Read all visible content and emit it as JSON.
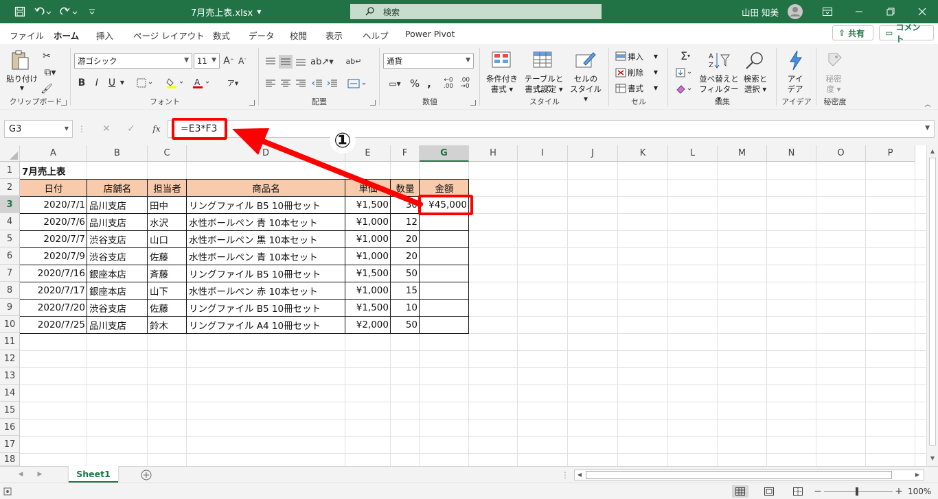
{
  "title": {
    "filename": "7月売上表.xlsx",
    "search": "検索",
    "user": "山田 知美"
  },
  "tabs": [
    "ファイル",
    "ホーム",
    "挿入",
    "ページ レイアウト",
    "数式",
    "データ",
    "校閲",
    "表示",
    "ヘルプ",
    "Power Pivot"
  ],
  "share_label": "共有",
  "comment_label": "コメント",
  "ribbon": {
    "clipboard": {
      "paste": "貼り付け",
      "label": "クリップボード"
    },
    "font": {
      "name": "游ゴシック",
      "size": "11",
      "bold": "B",
      "italic": "I",
      "underline": "U",
      "grow": "A^",
      "shrink": "Aˇ",
      "label": "フォント"
    },
    "alignment": {
      "label": "配置"
    },
    "number": {
      "format": "通貨",
      "label": "数値"
    },
    "styles": {
      "cond1": "条件付き",
      "cond2": "書式",
      "table1": "テーブルとして",
      "table2": "書式設定",
      "cell1": "セルの",
      "cell2": "スタイル",
      "label": "スタイル"
    },
    "cells": {
      "insert": "挿入",
      "delete": "削除",
      "format": "書式",
      "label": "セル"
    },
    "editing": {
      "sort1": "並べ替えと",
      "sort2": "フィルター",
      "find1": "検索と",
      "find2": "選択",
      "label": "編集"
    },
    "ideas": {
      "line1": "アイ",
      "line2": "デア",
      "label": "アイデア"
    },
    "sensitivity": {
      "line1": "秘密",
      "line2": "度",
      "label": "秘密度"
    }
  },
  "namebox": "G3",
  "formula": "=E3*F3",
  "callout": "①",
  "columns": [
    "A",
    "B",
    "C",
    "D",
    "E",
    "F",
    "G",
    "H",
    "I",
    "J",
    "K",
    "L",
    "M",
    "N",
    "O",
    "P"
  ],
  "rows": [
    "1",
    "2",
    "3",
    "4",
    "5",
    "6",
    "7",
    "8",
    "9",
    "10",
    "11",
    "12",
    "13",
    "14",
    "15",
    "16",
    "17",
    "18"
  ],
  "sheet": {
    "title": "7月売上表",
    "headers": [
      "日付",
      "店舗名",
      "担当者",
      "商品名",
      "単価",
      "数量",
      "金額"
    ],
    "data": [
      [
        "2020/7/1",
        "品川支店",
        "田中",
        "リングファイル B5 10冊セット",
        "¥1,500",
        "30",
        "¥45,000"
      ],
      [
        "2020/7/6",
        "品川支店",
        "水沢",
        "水性ボールペン 青 10本セット",
        "¥1,000",
        "12",
        ""
      ],
      [
        "2020/7/7",
        "渋谷支店",
        "山口",
        "水性ボールペン 黒 10本セット",
        "¥1,000",
        "20",
        ""
      ],
      [
        "2020/7/9",
        "渋谷支店",
        "佐藤",
        "水性ボールペン 青 10本セット",
        "¥1,000",
        "20",
        ""
      ],
      [
        "2020/7/16",
        "銀座本店",
        "斉藤",
        "リングファイル B5 10冊セット",
        "¥1,500",
        "50",
        ""
      ],
      [
        "2020/7/17",
        "銀座本店",
        "山下",
        "水性ボールペン 赤 10本セット",
        "¥1,000",
        "15",
        ""
      ],
      [
        "2020/7/20",
        "渋谷支店",
        "佐藤",
        "リングファイル B5 10冊セット",
        "¥1,500",
        "10",
        ""
      ],
      [
        "2020/7/25",
        "品川支店",
        "鈴木",
        "リングファイル A4 10冊セット",
        "¥2,000",
        "50",
        ""
      ]
    ]
  },
  "sheet_tab": "Sheet1",
  "zoom": "100%",
  "colors": {
    "accent": "#217346",
    "header_fill": "#f8cbad",
    "highlight": "#ff0000"
  }
}
